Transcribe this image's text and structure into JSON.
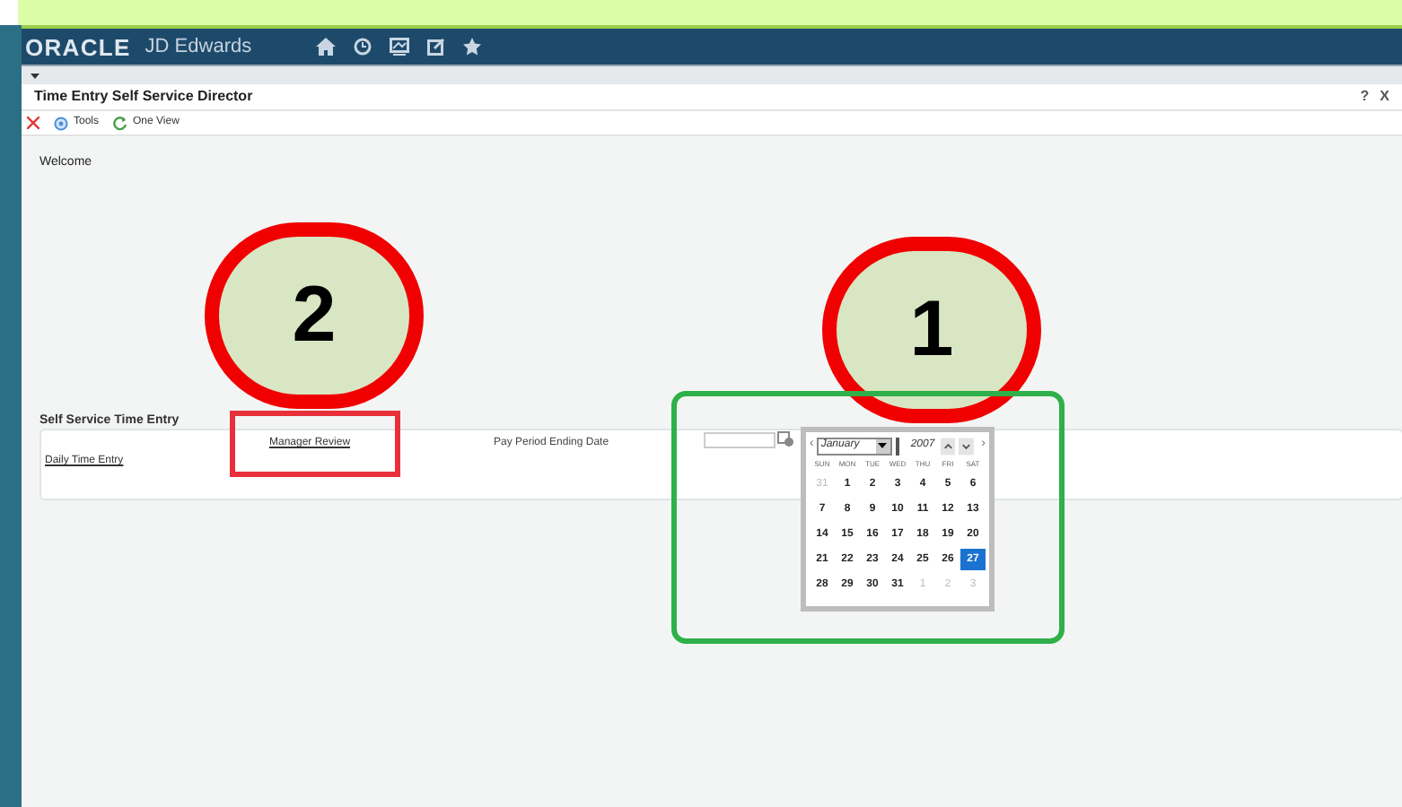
{
  "header": {
    "logo": "ORACLE",
    "product": "JD Edwards"
  },
  "form": {
    "title": "Time Entry Self Service Director",
    "help": "?",
    "close": "X",
    "toolbar": [
      {
        "kind": "close"
      },
      {
        "kind": "tools",
        "label": "Tools"
      },
      {
        "kind": "oneview",
        "label": "One View"
      }
    ]
  },
  "welcome": "Welcome",
  "section": {
    "title": "Self Service Time Entry",
    "links": [
      "Daily Time Entry",
      "Manager Review"
    ],
    "date_label": "Pay Period Ending Date"
  },
  "calendar": {
    "prev": "‹",
    "next": "›",
    "month": "January",
    "year": "2007",
    "weekdays": [
      "SUN",
      "MON",
      "TUE",
      "WED",
      "THU",
      "FRI",
      "SAT"
    ],
    "weeks": [
      [
        {
          "day": "31",
          "muted": true,
          "selected": false
        },
        {
          "day": "1",
          "muted": false,
          "selected": false
        },
        {
          "day": "2",
          "muted": false,
          "selected": false
        },
        {
          "day": "3",
          "muted": false,
          "selected": false
        },
        {
          "day": "4",
          "muted": false,
          "selected": false
        },
        {
          "day": "5",
          "muted": false,
          "selected": false
        },
        {
          "day": "6",
          "muted": false,
          "selected": false
        }
      ],
      [
        {
          "day": "7",
          "muted": false,
          "selected": false
        },
        {
          "day": "8",
          "muted": false,
          "selected": false
        },
        {
          "day": "9",
          "muted": false,
          "selected": false
        },
        {
          "day": "10",
          "muted": false,
          "selected": false
        },
        {
          "day": "11",
          "muted": false,
          "selected": false
        },
        {
          "day": "12",
          "muted": false,
          "selected": false
        },
        {
          "day": "13",
          "muted": false,
          "selected": false
        }
      ],
      [
        {
          "day": "14",
          "muted": false,
          "selected": false
        },
        {
          "day": "15",
          "muted": false,
          "selected": false
        },
        {
          "day": "16",
          "muted": false,
          "selected": false
        },
        {
          "day": "17",
          "muted": false,
          "selected": false
        },
        {
          "day": "18",
          "muted": false,
          "selected": false
        },
        {
          "day": "19",
          "muted": false,
          "selected": false
        },
        {
          "day": "20",
          "muted": false,
          "selected": false
        }
      ],
      [
        {
          "day": "21",
          "muted": false,
          "selected": false
        },
        {
          "day": "22",
          "muted": false,
          "selected": false
        },
        {
          "day": "23",
          "muted": false,
          "selected": false
        },
        {
          "day": "24",
          "muted": false,
          "selected": false
        },
        {
          "day": "25",
          "muted": false,
          "selected": false
        },
        {
          "day": "26",
          "muted": false,
          "selected": false
        },
        {
          "day": "27",
          "muted": false,
          "selected": true
        }
      ],
      [
        {
          "day": "28",
          "muted": false,
          "selected": false
        },
        {
          "day": "29",
          "muted": false,
          "selected": false
        },
        {
          "day": "30",
          "muted": false,
          "selected": false
        },
        {
          "day": "31",
          "muted": false,
          "selected": false
        },
        {
          "day": "1",
          "muted": true,
          "selected": false
        },
        {
          "day": "2",
          "muted": true,
          "selected": false
        },
        {
          "day": "3",
          "muted": true,
          "selected": false
        }
      ]
    ]
  },
  "annotations": [
    {
      "kind": "circle",
      "label": "2"
    },
    {
      "kind": "circle",
      "label": "1"
    },
    {
      "kind": "box",
      "color": "#e8303a"
    },
    {
      "kind": "box",
      "color": "#2fb04a"
    }
  ]
}
